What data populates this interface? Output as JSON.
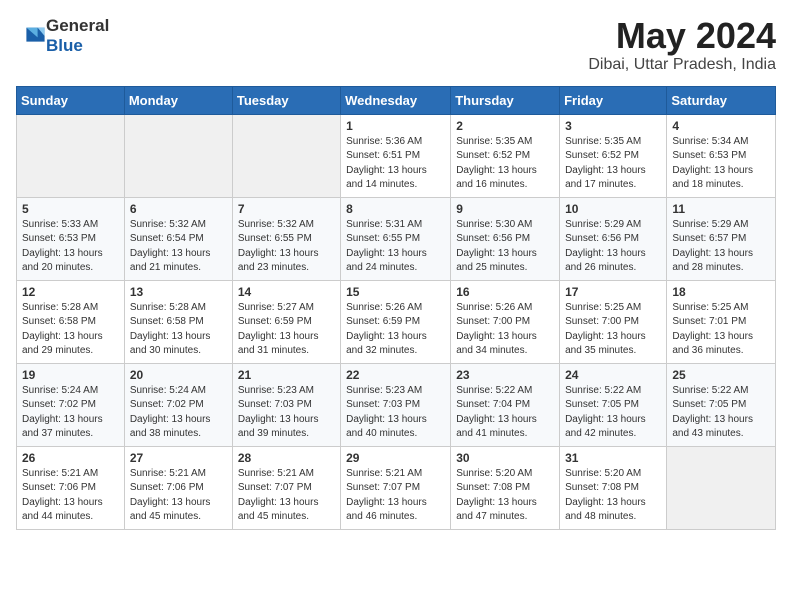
{
  "header": {
    "logo_general": "General",
    "logo_blue": "Blue",
    "month_year": "May 2024",
    "location": "Dibai, Uttar Pradesh, India"
  },
  "weekdays": [
    "Sunday",
    "Monday",
    "Tuesday",
    "Wednesday",
    "Thursday",
    "Friday",
    "Saturday"
  ],
  "weeks": [
    [
      {
        "day": "",
        "content": ""
      },
      {
        "day": "",
        "content": ""
      },
      {
        "day": "",
        "content": ""
      },
      {
        "day": "1",
        "content": "Sunrise: 5:36 AM\nSunset: 6:51 PM\nDaylight: 13 hours\nand 14 minutes."
      },
      {
        "day": "2",
        "content": "Sunrise: 5:35 AM\nSunset: 6:52 PM\nDaylight: 13 hours\nand 16 minutes."
      },
      {
        "day": "3",
        "content": "Sunrise: 5:35 AM\nSunset: 6:52 PM\nDaylight: 13 hours\nand 17 minutes."
      },
      {
        "day": "4",
        "content": "Sunrise: 5:34 AM\nSunset: 6:53 PM\nDaylight: 13 hours\nand 18 minutes."
      }
    ],
    [
      {
        "day": "5",
        "content": "Sunrise: 5:33 AM\nSunset: 6:53 PM\nDaylight: 13 hours\nand 20 minutes."
      },
      {
        "day": "6",
        "content": "Sunrise: 5:32 AM\nSunset: 6:54 PM\nDaylight: 13 hours\nand 21 minutes."
      },
      {
        "day": "7",
        "content": "Sunrise: 5:32 AM\nSunset: 6:55 PM\nDaylight: 13 hours\nand 23 minutes."
      },
      {
        "day": "8",
        "content": "Sunrise: 5:31 AM\nSunset: 6:55 PM\nDaylight: 13 hours\nand 24 minutes."
      },
      {
        "day": "9",
        "content": "Sunrise: 5:30 AM\nSunset: 6:56 PM\nDaylight: 13 hours\nand 25 minutes."
      },
      {
        "day": "10",
        "content": "Sunrise: 5:29 AM\nSunset: 6:56 PM\nDaylight: 13 hours\nand 26 minutes."
      },
      {
        "day": "11",
        "content": "Sunrise: 5:29 AM\nSunset: 6:57 PM\nDaylight: 13 hours\nand 28 minutes."
      }
    ],
    [
      {
        "day": "12",
        "content": "Sunrise: 5:28 AM\nSunset: 6:58 PM\nDaylight: 13 hours\nand 29 minutes."
      },
      {
        "day": "13",
        "content": "Sunrise: 5:28 AM\nSunset: 6:58 PM\nDaylight: 13 hours\nand 30 minutes."
      },
      {
        "day": "14",
        "content": "Sunrise: 5:27 AM\nSunset: 6:59 PM\nDaylight: 13 hours\nand 31 minutes."
      },
      {
        "day": "15",
        "content": "Sunrise: 5:26 AM\nSunset: 6:59 PM\nDaylight: 13 hours\nand 32 minutes."
      },
      {
        "day": "16",
        "content": "Sunrise: 5:26 AM\nSunset: 7:00 PM\nDaylight: 13 hours\nand 34 minutes."
      },
      {
        "day": "17",
        "content": "Sunrise: 5:25 AM\nSunset: 7:00 PM\nDaylight: 13 hours\nand 35 minutes."
      },
      {
        "day": "18",
        "content": "Sunrise: 5:25 AM\nSunset: 7:01 PM\nDaylight: 13 hours\nand 36 minutes."
      }
    ],
    [
      {
        "day": "19",
        "content": "Sunrise: 5:24 AM\nSunset: 7:02 PM\nDaylight: 13 hours\nand 37 minutes."
      },
      {
        "day": "20",
        "content": "Sunrise: 5:24 AM\nSunset: 7:02 PM\nDaylight: 13 hours\nand 38 minutes."
      },
      {
        "day": "21",
        "content": "Sunrise: 5:23 AM\nSunset: 7:03 PM\nDaylight: 13 hours\nand 39 minutes."
      },
      {
        "day": "22",
        "content": "Sunrise: 5:23 AM\nSunset: 7:03 PM\nDaylight: 13 hours\nand 40 minutes."
      },
      {
        "day": "23",
        "content": "Sunrise: 5:22 AM\nSunset: 7:04 PM\nDaylight: 13 hours\nand 41 minutes."
      },
      {
        "day": "24",
        "content": "Sunrise: 5:22 AM\nSunset: 7:05 PM\nDaylight: 13 hours\nand 42 minutes."
      },
      {
        "day": "25",
        "content": "Sunrise: 5:22 AM\nSunset: 7:05 PM\nDaylight: 13 hours\nand 43 minutes."
      }
    ],
    [
      {
        "day": "26",
        "content": "Sunrise: 5:21 AM\nSunset: 7:06 PM\nDaylight: 13 hours\nand 44 minutes."
      },
      {
        "day": "27",
        "content": "Sunrise: 5:21 AM\nSunset: 7:06 PM\nDaylight: 13 hours\nand 45 minutes."
      },
      {
        "day": "28",
        "content": "Sunrise: 5:21 AM\nSunset: 7:07 PM\nDaylight: 13 hours\nand 45 minutes."
      },
      {
        "day": "29",
        "content": "Sunrise: 5:21 AM\nSunset: 7:07 PM\nDaylight: 13 hours\nand 46 minutes."
      },
      {
        "day": "30",
        "content": "Sunrise: 5:20 AM\nSunset: 7:08 PM\nDaylight: 13 hours\nand 47 minutes."
      },
      {
        "day": "31",
        "content": "Sunrise: 5:20 AM\nSunset: 7:08 PM\nDaylight: 13 hours\nand 48 minutes."
      },
      {
        "day": "",
        "content": ""
      }
    ]
  ]
}
